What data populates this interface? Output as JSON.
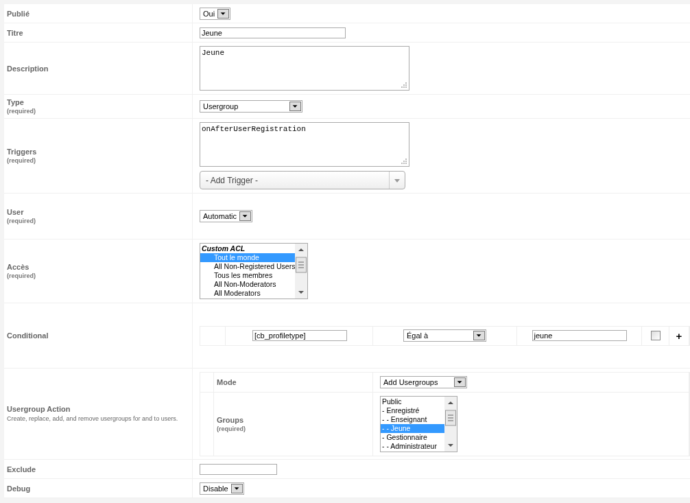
{
  "rows": [
    {
      "label": "Publié",
      "kind": "select",
      "value": "Oui"
    },
    {
      "label": "Titre",
      "kind": "text",
      "value": "Jeune"
    },
    {
      "label": "Description",
      "kind": "textarea",
      "value": "Jeune"
    },
    {
      "label": "Type",
      "note": "(required)",
      "kind": "select",
      "value": "Usergroup"
    },
    {
      "label": "Triggers",
      "note": "(required)",
      "kind": "triggers",
      "value": "onAfterUserRegistration",
      "add_placeholder": "- Add Trigger -"
    },
    {
      "label": "User",
      "note": "(required)",
      "kind": "select",
      "value": "Automatic"
    },
    {
      "label": "Accès",
      "note": "(required)",
      "kind": "listbox",
      "options": [
        {
          "label": "Custom ACL",
          "kind": "group",
          "selected": false
        },
        {
          "label": "Tout le monde",
          "kind": "option",
          "selected": true
        },
        {
          "label": "All Non-Registered Users",
          "kind": "option",
          "selected": false
        },
        {
          "label": "Tous les membres",
          "kind": "option",
          "selected": false
        },
        {
          "label": "All Non-Moderators",
          "kind": "option",
          "selected": false
        },
        {
          "label": "All Moderators",
          "kind": "option",
          "selected": false
        }
      ]
    },
    {
      "label": "Conditional",
      "kind": "conditional",
      "field": "[cb_profiletype]",
      "operator": "Égal à",
      "value": "jeune",
      "checked": false,
      "add": "+"
    },
    {
      "label": "Usergroup Action",
      "kind": "action",
      "description": "Create, replace, add, and remove usergroups for and to users.",
      "mode_label": "Mode",
      "mode": "Add Usergroups",
      "groups_label": "Groups",
      "groups_note": "(required)",
      "groups": [
        {
          "label": "Public",
          "kind": "option",
          "selected": false
        },
        {
          "label": "- Enregistré",
          "kind": "option",
          "selected": false
        },
        {
          "label": "- - Enseignant",
          "kind": "option",
          "selected": false
        },
        {
          "label": "- - Jeune",
          "kind": "option",
          "selected": true
        },
        {
          "label": "- Gestionnaire",
          "kind": "option",
          "selected": false
        },
        {
          "label": "- - Administrateur",
          "kind": "option",
          "selected": false
        }
      ]
    },
    {
      "label": "Exclude",
      "kind": "text",
      "value": ""
    },
    {
      "label": "Debug",
      "kind": "select",
      "value": "Disable"
    }
  ]
}
